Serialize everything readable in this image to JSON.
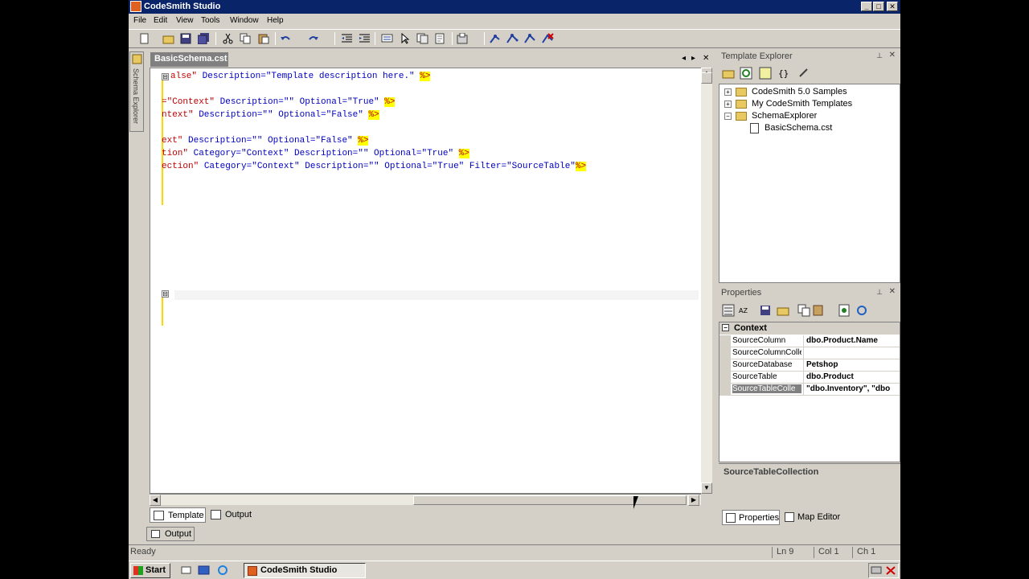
{
  "window": {
    "title": "CodeSmith Studio",
    "controls": [
      "_",
      "□",
      "✕"
    ]
  },
  "menu": [
    "File",
    "Edit",
    "View",
    "Tools",
    "Window",
    "Help"
  ],
  "side_tab": {
    "label": "Schema Explorer"
  },
  "editor": {
    "tab_label": "BasicSchema.cst",
    "tab_controls": [
      "◂",
      "▸",
      "✕"
    ],
    "lines": [
      {
        "k1": "alse\"",
        "rest": " Description=\"Template description here.\" ",
        "tag": "%>"
      },
      {
        "k1": "=\"Context\"",
        "rest": " Description=\"\" Optional=\"True\" ",
        "tag": "%>"
      },
      {
        "k1": "ntext\"",
        "rest": " Description=\"\" Optional=\"False\" ",
        "tag": "%>"
      },
      {
        "k1": "ext\"",
        "rest": " Description=\"\" Optional=\"False\" ",
        "tag": "%>"
      },
      {
        "k1": "tion\"",
        "rest": " Category=\"Context\" Description=\"\" Optional=\"True\" ",
        "tag": "%>"
      },
      {
        "k1": "ection\"",
        "rest": " Category=\"Context\" Description=\"\" Optional=\"True\" Filter=\"SourceTable\"",
        "tag": "%>"
      }
    ],
    "fold_marks": [
      "⊟",
      "⊟"
    ]
  },
  "bottom_tabs": [
    "Template",
    "Output"
  ],
  "output_bar": "Output",
  "template_explorer": {
    "title": "Template Explorer",
    "items": [
      {
        "label": "CodeSmith 5.0 Samples",
        "expander": "+"
      },
      {
        "label": "My CodeSmith Templates",
        "expander": "+"
      },
      {
        "label": "SchemaExplorer",
        "expander": "−"
      },
      {
        "label": "BasicSchema.cst",
        "expander": ""
      }
    ]
  },
  "properties": {
    "title": "Properties",
    "category": "Context",
    "rows": [
      {
        "name": "SourceColumn",
        "value": "dbo.Product.Name"
      },
      {
        "name": "SourceColumnColle",
        "value": ""
      },
      {
        "name": "SourceDatabase",
        "value": "Petshop"
      },
      {
        "name": "SourceTable",
        "value": "dbo.Product"
      },
      {
        "name": "SourceTableColle",
        "value": "\"dbo.Inventory\", \"dbo"
      }
    ],
    "selected_description": "SourceTableCollection",
    "tabs": [
      "Properties",
      "Map Editor"
    ]
  },
  "status": {
    "left": "Ready",
    "ln": "Ln 9",
    "col": "Col 1",
    "ch": "Ch 1"
  },
  "taskbar": {
    "start": "Start",
    "task": "CodeSmith Studio"
  },
  "colors": {
    "titlebar": "#0a246a",
    "chrome": "#d4d0c8",
    "keyword": "#c00000",
    "string": "#0000c0",
    "tag_highlight": "#ffff00"
  }
}
